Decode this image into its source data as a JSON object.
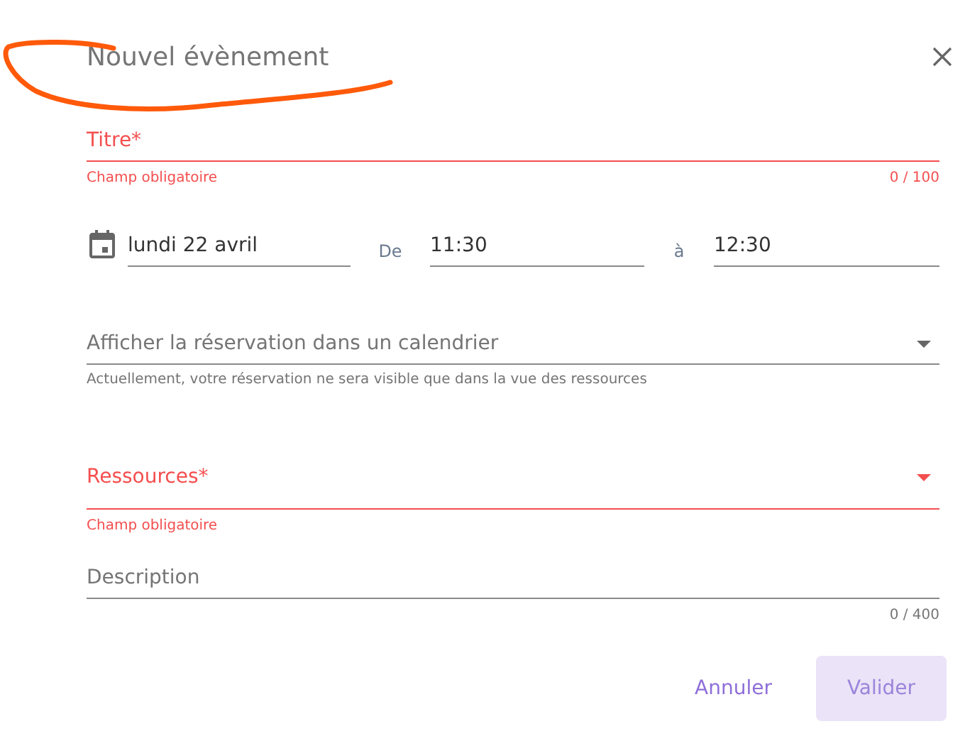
{
  "dialog": {
    "title": "Nouvel évènement"
  },
  "title_field": {
    "label": "Titre*",
    "invalid": true,
    "helper": "Champ obligatoire",
    "counter": "0 / 100"
  },
  "date_row": {
    "date": "lundi 22 avril",
    "from_label": "De",
    "start": "11:30",
    "to_label": "à",
    "end": "12:30"
  },
  "calendar_select": {
    "label": "Afficher la réservation dans un calendrier",
    "invalid": false,
    "helper": "Actuellement, votre réservation ne sera visible que dans la vue des ressources"
  },
  "resources_select": {
    "label": "Ressources*",
    "invalid": true,
    "helper": "Champ obligatoire"
  },
  "description_field": {
    "label": "Description",
    "invalid": false,
    "counter": "0 / 400"
  },
  "buttons": [
    {
      "label": "Annuler",
      "kind": "text",
      "disabled": false
    },
    {
      "label": "Valider",
      "kind": "filled",
      "disabled": true
    }
  ]
}
